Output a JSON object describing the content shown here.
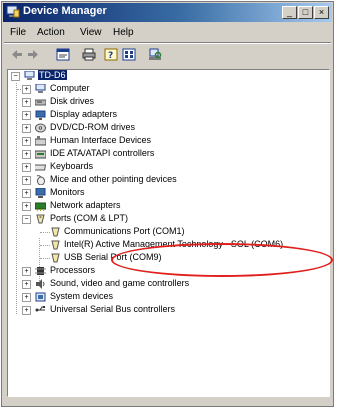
{
  "window": {
    "title": "Device Manager",
    "buttons": [
      "_",
      "□",
      "×"
    ]
  },
  "menu": [
    {
      "label": "File",
      "id": "file"
    },
    {
      "label": "Action",
      "id": "action"
    },
    {
      "label": "View",
      "id": "view"
    },
    {
      "label": "Help",
      "id": "help"
    }
  ],
  "toolbar": [
    "back-icon",
    "forward-icon",
    "properties-icon",
    "print-icon",
    "help-icon",
    "view-icon",
    "scan-icon"
  ],
  "tree": {
    "root": "TD-D6",
    "nodes": [
      {
        "label": "Computer",
        "icon": "computer-icon"
      },
      {
        "label": "Disk drives",
        "icon": "disk-icon"
      },
      {
        "label": "Display adapters",
        "icon": "display-icon"
      },
      {
        "label": "DVD/CD-ROM drives",
        "icon": "cdrom-icon"
      },
      {
        "label": "Human Interface Devices",
        "icon": "hid-icon"
      },
      {
        "label": "IDE ATA/ATAPI controllers",
        "icon": "ide-icon"
      },
      {
        "label": "Keyboards",
        "icon": "keyboard-icon"
      },
      {
        "label": "Mice and other pointing devices",
        "icon": "mouse-icon"
      },
      {
        "label": "Monitors",
        "icon": "monitor-icon"
      },
      {
        "label": "Network adapters",
        "icon": "network-icon"
      },
      {
        "label": "Ports (COM & LPT)",
        "icon": "port-icon",
        "expanded": true,
        "children": [
          {
            "label": "Communications Port (COM1)",
            "icon": "port-icon"
          },
          {
            "label": "Intel(R) Active Management Technology - SOL (COM6)",
            "icon": "port-icon"
          },
          {
            "label": "USB Serial Port (COM9)",
            "icon": "port-icon"
          }
        ]
      },
      {
        "label": "Processors",
        "icon": "processor-icon"
      },
      {
        "label": "Sound, video and game controllers",
        "icon": "sound-icon"
      },
      {
        "label": "System devices",
        "icon": "system-icon"
      },
      {
        "label": "Universal Serial Bus controllers",
        "icon": "usb-icon"
      }
    ]
  },
  "highlight_color": "#e0201c",
  "selection_color": "#0a246a"
}
